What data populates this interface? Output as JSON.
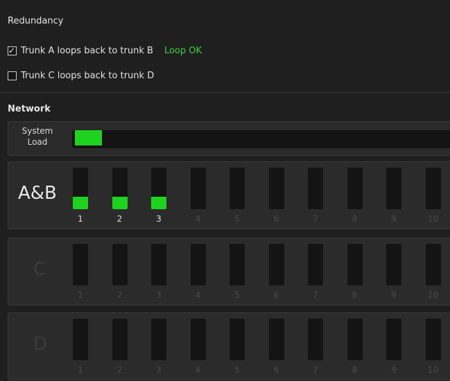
{
  "redundancy": {
    "title": "Redundancy",
    "options": [
      {
        "label": "Trunk A loops back to trunk B",
        "checked": true,
        "status": "Loop OK",
        "status_color": "#3fd13f"
      },
      {
        "label": "Trunk C loops back to trunk D",
        "checked": false,
        "status": ""
      }
    ]
  },
  "network": {
    "title": "Network",
    "system_load": {
      "label_line1": "System",
      "label_line2": "Load",
      "level": 0.07,
      "color": "#1fd21f"
    },
    "trunks": [
      {
        "label": "A&B",
        "active": true,
        "channels": [
          "1",
          "2",
          "3",
          "4",
          "5",
          "6",
          "7",
          "8",
          "9",
          "10"
        ],
        "levels": [
          0.3,
          0.3,
          0.3,
          0,
          0,
          0,
          0,
          0,
          0,
          0
        ]
      },
      {
        "label": "C",
        "active": false,
        "channels": [
          "1",
          "2",
          "3",
          "4",
          "5",
          "6",
          "7",
          "8",
          "9",
          "10"
        ],
        "levels": [
          0,
          0,
          0,
          0,
          0,
          0,
          0,
          0,
          0,
          0
        ]
      },
      {
        "label": "D",
        "active": false,
        "channels": [
          "1",
          "2",
          "3",
          "4",
          "5",
          "6",
          "7",
          "8",
          "9",
          "10"
        ],
        "levels": [
          0,
          0,
          0,
          0,
          0,
          0,
          0,
          0,
          0,
          0
        ]
      }
    ],
    "meter_color": "#1fd21f"
  }
}
